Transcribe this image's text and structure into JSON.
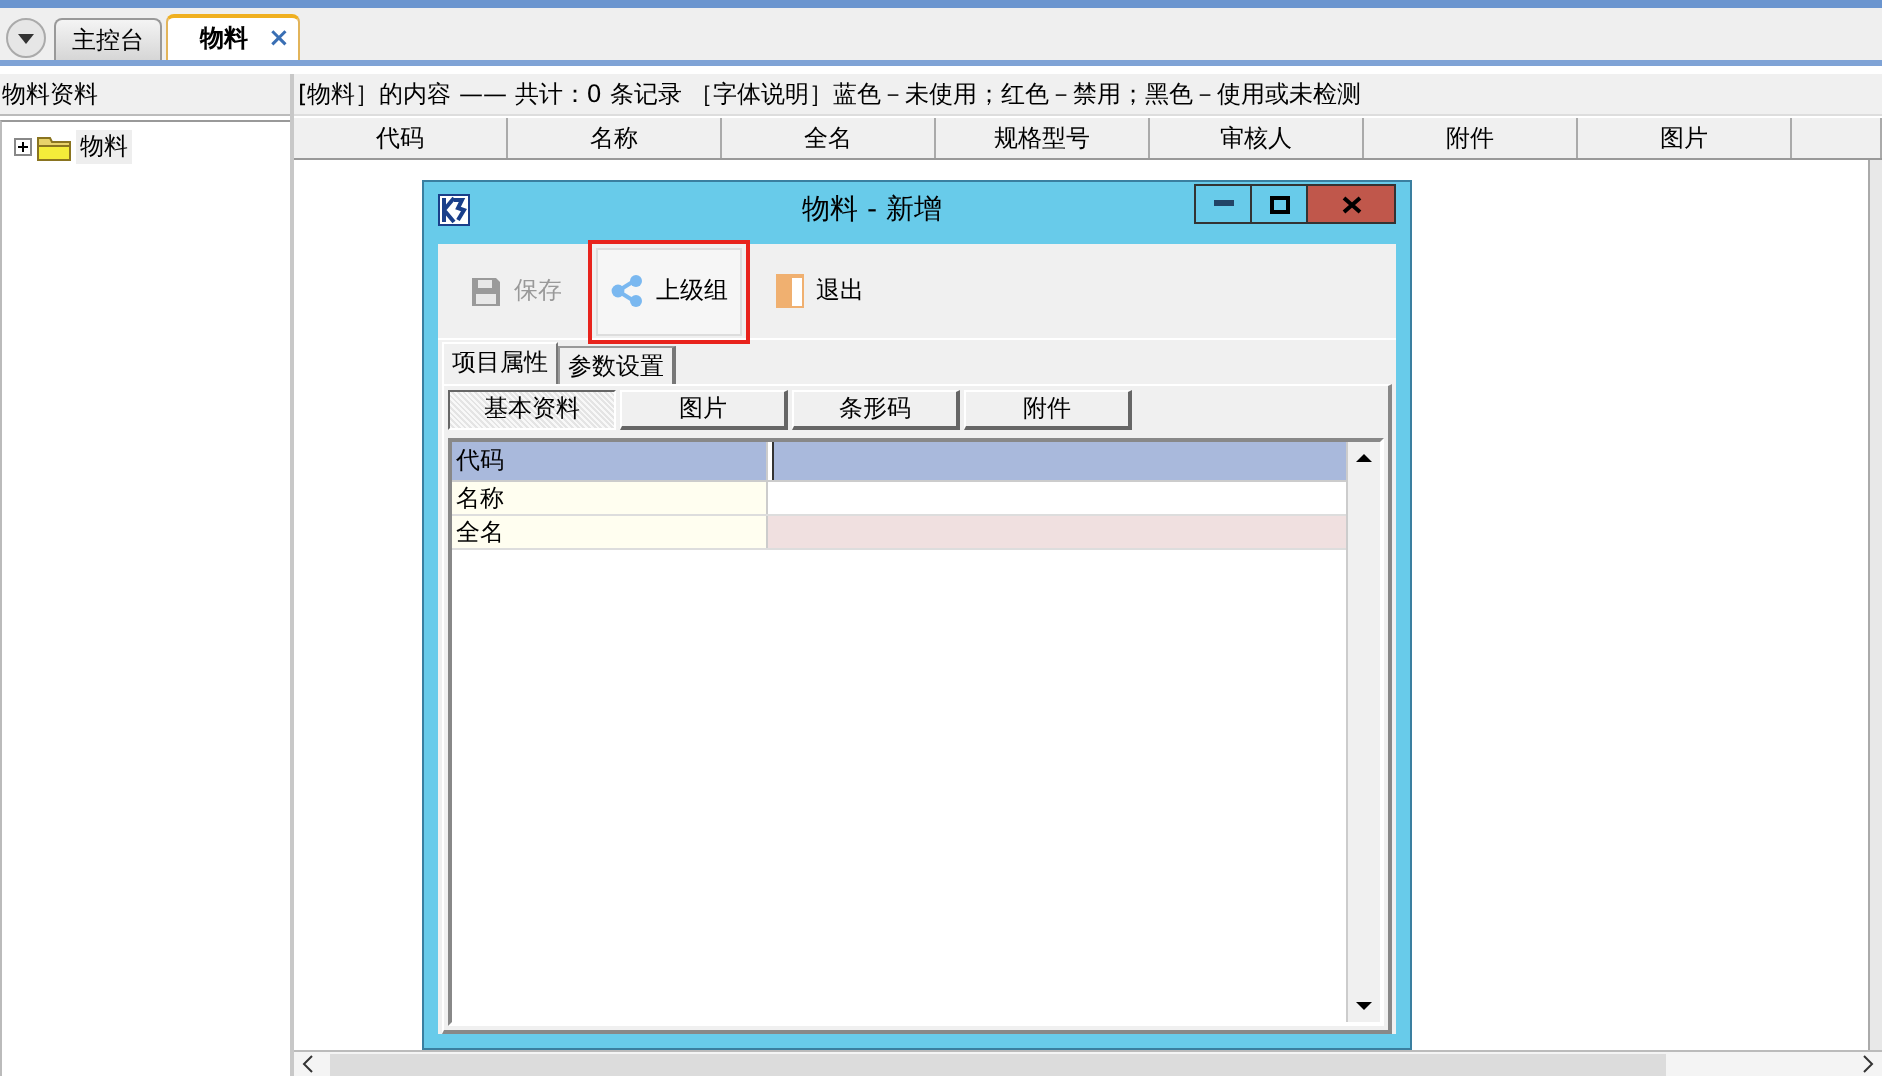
{
  "tabs": [
    {
      "label": "主控台",
      "selected": false
    },
    {
      "label": "物料",
      "selected": true,
      "close": "×"
    }
  ],
  "tree": {
    "title": "物料资料",
    "items": [
      {
        "label": "物料",
        "expanded": false
      }
    ]
  },
  "content": {
    "summary": "[物料］的内容 —— 共计：0 条记录 ［字体说明］蓝色－未使用；红色－禁用；黑色－使用或未检测",
    "columns": [
      "代码",
      "名称",
      "全名",
      "规格型号",
      "审核人",
      "附件",
      "图片"
    ]
  },
  "dialog": {
    "title": "物料 - 新增",
    "toolbar": [
      {
        "label": "保存",
        "disabled": true,
        "highlighted": false
      },
      {
        "label": "上级组",
        "disabled": false,
        "highlighted": true
      },
      {
        "label": "退出",
        "disabled": false,
        "highlighted": false
      }
    ],
    "tabs": [
      {
        "label": "项目属性",
        "selected": true
      },
      {
        "label": "参数设置",
        "selected": false
      }
    ],
    "subtabs": [
      {
        "label": "基本资料",
        "selected": true
      },
      {
        "label": "图片",
        "selected": false
      },
      {
        "label": "条形码",
        "selected": false
      },
      {
        "label": "附件",
        "selected": false
      }
    ],
    "fields": [
      {
        "label": "代码",
        "kind": "text",
        "selected": true
      },
      {
        "label": "名称",
        "kind": "text",
        "selected": false
      },
      {
        "label": "全名",
        "kind": "required",
        "selected": false
      }
    ]
  }
}
